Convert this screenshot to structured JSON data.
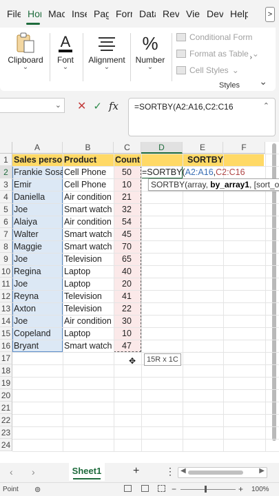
{
  "ribbon_tabs": [
    "File",
    "Hom",
    "Macr",
    "Inser",
    "Page",
    "Form",
    "Data",
    "Revie",
    "View",
    "Deve",
    "Help"
  ],
  "ribbon_more": ">",
  "ribbon": {
    "clipboard": "Clipboard",
    "font": "Font",
    "alignment": "Alignment",
    "number": "Number",
    "styles_items": [
      "Conditional Form",
      "Format as Table",
      "Cell Styles"
    ],
    "styles_label": "Styles"
  },
  "formula_bar": {
    "name_box": "",
    "formula": "=SORTBY(A2:A16,C2:C16"
  },
  "columns": [
    "A",
    "B",
    "C",
    "D",
    "E",
    "F"
  ],
  "rows": [
    "1",
    "2",
    "3",
    "4",
    "5",
    "6",
    "7",
    "8",
    "9",
    "10",
    "11",
    "12",
    "13",
    "14",
    "15",
    "16",
    "17",
    "18",
    "19",
    "20",
    "21",
    "22",
    "23",
    "24"
  ],
  "headers": {
    "a": "Sales person",
    "b": "Product",
    "c": "Count",
    "e": "SORTBY"
  },
  "table": [
    {
      "person": "Frankie Sosa",
      "product": "Cell Phone",
      "count": "50"
    },
    {
      "person": "Emir",
      "product": "Cell Phone",
      "count": "10"
    },
    {
      "person": "Daniella",
      "product": "Air condition",
      "count": "21"
    },
    {
      "person": "Joe",
      "product": "Smart watch",
      "count": "32"
    },
    {
      "person": "Alaiya",
      "product": "Air condition",
      "count": "54"
    },
    {
      "person": "Walter",
      "product": "Smart watch",
      "count": "45"
    },
    {
      "person": "Maggie",
      "product": "Smart watch",
      "count": "70"
    },
    {
      "person": "Joe",
      "product": "Television",
      "count": "65"
    },
    {
      "person": "Regina",
      "product": "Laptop",
      "count": "40"
    },
    {
      "person": "Joe",
      "product": "Laptop",
      "count": "20"
    },
    {
      "person": "Reyna",
      "product": "Television",
      "count": "41"
    },
    {
      "person": "Axton",
      "product": "Television",
      "count": "22"
    },
    {
      "person": "Joe",
      "product": "Air condition",
      "count": "30"
    },
    {
      "person": "Copeland",
      "product": "Laptop",
      "count": "10"
    },
    {
      "person": "Bryant",
      "product": "Smart watch",
      "count": "47"
    }
  ],
  "edit_cell": {
    "prefix": "=SORTBY(",
    "ref1": "A2:A16",
    "sep": ",",
    "ref2": "C2:C16"
  },
  "tooltip": {
    "pre": "SORTBY(array, ",
    "bold": "by_array1",
    "post": ", [sort_order"
  },
  "size_tip": "15R x 1C",
  "sheet_tab": "Sheet1",
  "status": {
    "mode": "Point",
    "zoom": "100%"
  },
  "colors": {
    "accent": "#1e6b3c",
    "header_band": "#ffd966",
    "range_a": "#dce8f5",
    "range_c": "#fbe9e9",
    "ref_blue": "#3a6fb5",
    "ref_red": "#b04545"
  }
}
